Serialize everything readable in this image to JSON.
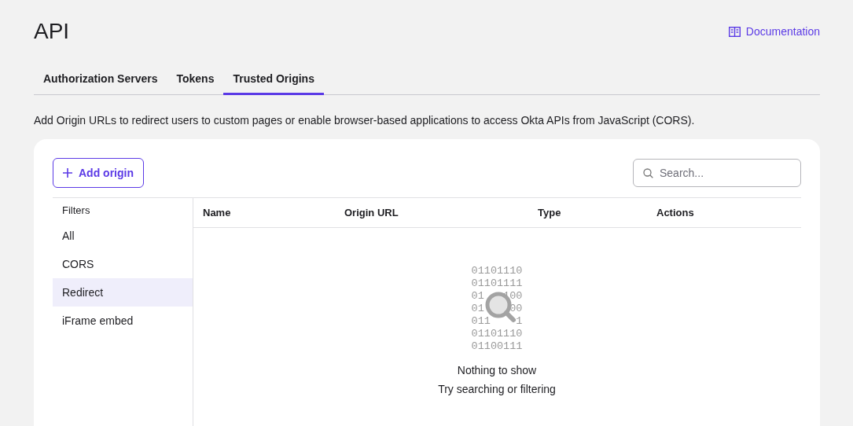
{
  "page": {
    "title": "API",
    "doc_link": "Documentation"
  },
  "tabs": [
    {
      "label": "Authorization Servers",
      "selected": false
    },
    {
      "label": "Tokens",
      "selected": false
    },
    {
      "label": "Trusted Origins",
      "selected": true
    }
  ],
  "description": "Add Origin URLs to redirect users to custom pages or enable browser-based applications to access Okta APIs from JavaScript (CORS).",
  "toolbar": {
    "add_button": "Add origin",
    "search": {
      "placeholder": "Search..."
    }
  },
  "filters": {
    "heading": "Filters",
    "items": [
      {
        "label": "All",
        "selected": false
      },
      {
        "label": "CORS",
        "selected": false
      },
      {
        "label": "Redirect",
        "selected": true
      },
      {
        "label": "iFrame embed",
        "selected": false
      }
    ]
  },
  "table": {
    "columns": [
      "Name",
      "Origin URL",
      "Type",
      "Actions"
    ]
  },
  "empty_state": {
    "binary_lines": [
      [
        "01101110"
      ],
      [
        "01101111"
      ],
      [
        "01",
        "100"
      ],
      [
        "01",
        "00"
      ],
      [
        "011",
        "1"
      ],
      [
        "01101110"
      ],
      [
        "01100111"
      ]
    ],
    "title": "Nothing to show",
    "hint": "Try searching or filtering"
  }
}
